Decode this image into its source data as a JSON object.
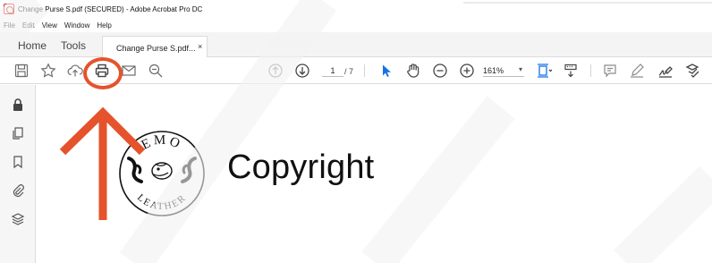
{
  "window": {
    "title": "Change Purse S.pdf (SECURED) - Adobe Acrobat Pro DC"
  },
  "menu": [
    "File",
    "Edit",
    "View",
    "Window",
    "Help"
  ],
  "tabs": {
    "home": "Home",
    "tools": "Tools",
    "document": "Change Purse S.pdf...",
    "close": "×"
  },
  "toolbar": {
    "page_current": "1",
    "page_total": "/ 7",
    "zoom": "161%",
    "zoom_caret": "▾"
  },
  "document": {
    "heading": "Copyright",
    "logo_text_top": "EMO",
    "logo_text_bottom": "LEATHER"
  },
  "colors": {
    "acrobat_red": "#d0271d",
    "annotation_orange": "#e5532c",
    "select_tool_blue": "#1473e6"
  },
  "icons": {
    "save": "save-icon",
    "bookmark_star": "star-icon",
    "upload": "upload-cloud-icon",
    "print": "print-icon",
    "mail": "mail-icon",
    "search": "zoom-search-icon",
    "prev_page": "arrow-up-circle-icon",
    "next_page": "arrow-down-circle-icon",
    "select": "pointer-icon",
    "hand": "hand-icon",
    "zoom_out": "minus-circle-icon",
    "zoom_in": "plus-circle-icon",
    "fit": "fit-page-icon",
    "scroll": "scroll-mode-icon",
    "comment": "comment-icon",
    "highlight": "pen-icon",
    "sign": "sign-icon",
    "fill": "fill-sign-icon"
  }
}
